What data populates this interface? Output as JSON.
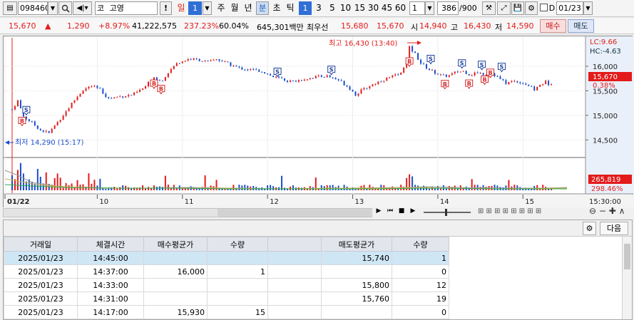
{
  "toolbar": {
    "code": "098460",
    "market_prefix": "코",
    "stock_name": "고영",
    "alert_label": "!",
    "period_day": "일",
    "period_num": "1",
    "week": "주",
    "month": "월",
    "year": "년",
    "minute": "분",
    "second": "초",
    "tick": "틱",
    "intervals": [
      "1",
      "3",
      "5",
      "10",
      "15",
      "30",
      "45",
      "60"
    ],
    "selected_interval": "1",
    "interval_select": "1",
    "count_value": "386",
    "count_total": "/900",
    "date_value": "01/23",
    "checkbox_label": "D"
  },
  "quote": {
    "price": "15,670",
    "arrow": "▲",
    "change": "1,290",
    "change_rate": "+8.97%",
    "volume": "41,222,575",
    "vol_ratio": "237.23%",
    "turnover": "60.04%",
    "amount": "645,301백만",
    "best_label": "최우선",
    "best_ask": "15,680",
    "best_bid": "15,670",
    "open_label": "시",
    "open": "14,940",
    "high_label": "고",
    "high": "16,430",
    "low_label": "저",
    "low": "14,590",
    "buy_label": "매수",
    "sell_label": "매도"
  },
  "chart": {
    "y_ticks": [
      "16,000",
      "15,500",
      "15,000",
      "14,500"
    ],
    "lc_label": "LC:9.66",
    "hc_label": "HC:-4.63",
    "current_price_label": "15,670",
    "current_pct_label": "0.38%",
    "high_annotation": "최고 16,430 (13:40)",
    "low_annotation": "최저 14,290 (15:17)",
    "volume_label": "265,819",
    "volume_pct_label": "298.46%",
    "x_labels": [
      "01/22",
      "10",
      "11",
      "12",
      "13",
      "14",
      "15"
    ],
    "time_label": "15:30:00",
    "marker_buy": "B",
    "marker_sell": "S",
    "colors": {
      "up": "#e31b1b",
      "down": "#1a4ecb",
      "buy_marker": "#d32a2a",
      "sell_marker": "#1d3f9a"
    }
  },
  "chart_data": {
    "type": "candlestick",
    "symbol": "098460",
    "name": "고영",
    "interval": "1분",
    "price_axis": {
      "ticks": [
        16000,
        15500,
        15000,
        14500
      ],
      "range": [
        14200,
        16550
      ]
    },
    "x_ticks": [
      "01/22",
      "10",
      "11",
      "12",
      "13",
      "14",
      "15"
    ],
    "marks": {
      "high": {
        "value": 16430,
        "time": "13:40"
      },
      "low": {
        "value": 14290,
        "time": "15:17"
      }
    },
    "current": 15670,
    "trades": [
      {
        "time": "09:07",
        "type": "B",
        "price": 15020
      },
      {
        "time": "09:10",
        "type": "S",
        "price": 14980
      },
      {
        "time": "10:40",
        "type": "B",
        "price": 15780
      },
      {
        "time": "10:45",
        "type": "B",
        "price": 15670
      },
      {
        "time": "12:07",
        "type": "S",
        "price": 15760
      },
      {
        "time": "12:45",
        "type": "S",
        "price": 15800
      },
      {
        "time": "13:40",
        "type": "B",
        "price": 16230
      },
      {
        "time": "13:55",
        "type": "S",
        "price": 16020
      },
      {
        "time": "14:05",
        "type": "B",
        "price": 15770
      },
      {
        "time": "14:17",
        "type": "S",
        "price": 15930
      },
      {
        "time": "14:22",
        "type": "B",
        "price": 15780
      },
      {
        "time": "14:31",
        "type": "S",
        "price": 15900
      },
      {
        "time": "14:33",
        "type": "B",
        "price": 15860
      },
      {
        "time": "14:37",
        "type": "B",
        "price": 16000
      },
      {
        "time": "14:45",
        "type": "S",
        "price": 15860
      }
    ]
  },
  "grid": {
    "next_label": "다음",
    "headers": [
      "거래일",
      "체결시간",
      "매수평균가",
      "수량",
      "",
      "매도평균가",
      "수량"
    ],
    "rows": [
      [
        "2025/01/23",
        "14:45:00",
        "",
        "",
        "",
        "15,740",
        "1"
      ],
      [
        "2025/01/23",
        "14:37:00",
        "16,000",
        "1",
        "",
        "",
        "0"
      ],
      [
        "2025/01/23",
        "14:33:00",
        "",
        "",
        "",
        "15,800",
        "12"
      ],
      [
        "2025/01/23",
        "14:31:00",
        "",
        "",
        "",
        "15,760",
        "19"
      ],
      [
        "2025/01/23",
        "14:17:00",
        "15,930",
        "15",
        "",
        "",
        "0"
      ]
    ]
  }
}
